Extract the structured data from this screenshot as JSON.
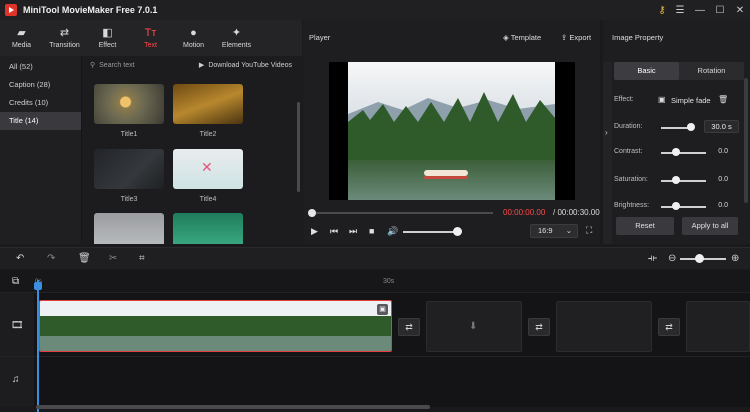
{
  "app": {
    "title": "MiniTool MovieMaker Free 7.0.1"
  },
  "toolbar": {
    "tabs": [
      {
        "label": "Media",
        "icon": "folder-icon"
      },
      {
        "label": "Transition",
        "icon": "transition-icon"
      },
      {
        "label": "Effect",
        "icon": "effect-icon"
      },
      {
        "label": "Text",
        "icon": "text-icon",
        "active": true
      },
      {
        "label": "Motion",
        "icon": "motion-icon"
      },
      {
        "label": "Elements",
        "icon": "elements-icon"
      }
    ]
  },
  "categories": [
    {
      "label": "All (52)"
    },
    {
      "label": "Caption (28)"
    },
    {
      "label": "Credits (10)"
    },
    {
      "label": "Title (14)",
      "active": true
    }
  ],
  "library": {
    "search_placeholder": "Search text",
    "download_label": "Download YouTube Videos",
    "items": [
      {
        "label": "Title1"
      },
      {
        "label": "Title2"
      },
      {
        "label": "Title3"
      },
      {
        "label": "Title4"
      },
      {
        "label": ""
      },
      {
        "label": ""
      }
    ]
  },
  "player": {
    "title": "Player",
    "template_label": "Template",
    "export_label": "Export",
    "time_current": "00:00:00.00",
    "time_total": "/ 00:00:30.00",
    "aspect_ratio": "16:9",
    "progress_fraction": 0,
    "volume_fraction": 1
  },
  "property": {
    "title": "Image Property",
    "tabs": {
      "basic": "Basic",
      "rotation": "Rotation"
    },
    "effect_label": "Effect:",
    "effect_value": "Simple fade",
    "duration_label": "Duration:",
    "duration_value": "30.0 s",
    "contrast_label": "Contrast:",
    "contrast_value": "0.0",
    "saturation_label": "Saturation:",
    "saturation_value": "0.0",
    "brightness_label": "Brightness:",
    "brightness_value": "0.0",
    "reset_label": "Reset",
    "apply_label": "Apply to all"
  },
  "timeline": {
    "ruler_start": "0s",
    "ruler_mark": "30s"
  },
  "colors": {
    "accent": "#ff4a4a",
    "playhead": "#3b8fe0"
  }
}
